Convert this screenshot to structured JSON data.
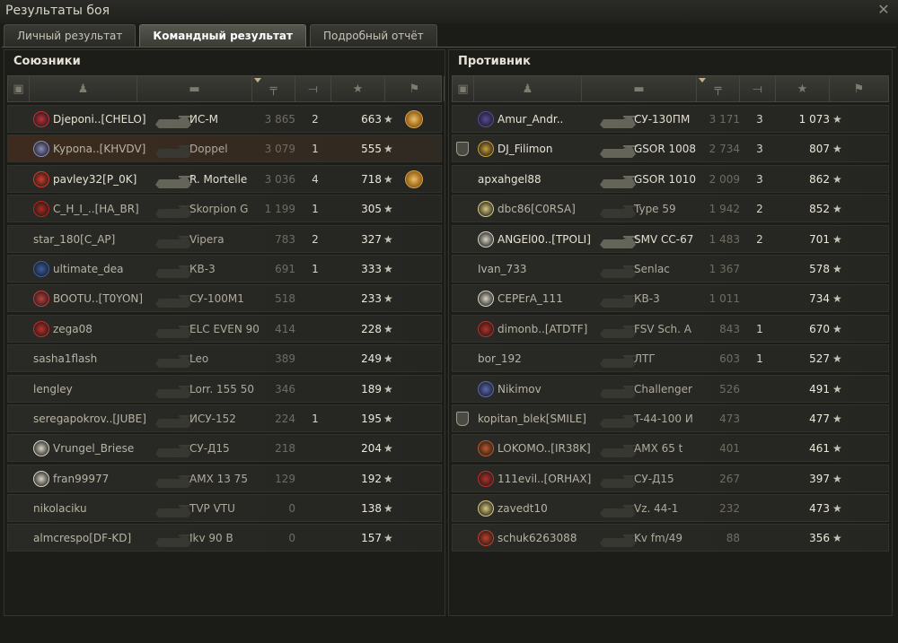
{
  "window": {
    "title": "Результаты боя",
    "close_glyph": "✕"
  },
  "tabs": [
    {
      "label": "Личный результат",
      "active": false
    },
    {
      "label": "Командный результат",
      "active": true
    },
    {
      "label": "Подробный отчёт",
      "active": false
    }
  ],
  "allies": {
    "title": "Союзники",
    "rows": [
      {
        "player": "Djeponi..[CHELO]",
        "clan_icon": "red-circle-clan-icon",
        "clan_color": "#c0303a",
        "vehicle": "ИС-М",
        "damage": "3 865",
        "kills": "2",
        "xp": "663",
        "medal": true,
        "alive": true
      },
      {
        "player": "Kypona..[KHVDV]",
        "clan_icon": "white-swirl-clan-icon",
        "clan_color": "#8a8cc0",
        "vehicle": "Doppel",
        "damage": "3 079",
        "kills": "1",
        "xp": "555",
        "medal": false,
        "alive": false,
        "highlight": true
      },
      {
        "player": "pavley32[P_0K]",
        "clan_icon": "red-triangle-clan-icon",
        "clan_color": "#d63a2a",
        "vehicle": "R. Mortelle",
        "damage": "3 036",
        "kills": "4",
        "xp": "718",
        "medal": true,
        "alive": true
      },
      {
        "player": "C_H_I_..[HA_BR]",
        "clan_icon": "red-flag-clan-icon",
        "clan_color": "#b02a22",
        "vehicle": "Skorpion G",
        "damage": "1 199",
        "kills": "1",
        "xp": "305",
        "medal": false,
        "alive": false
      },
      {
        "player": "star_180[C_AP]",
        "clan_icon": "",
        "clan_color": "",
        "vehicle": "Vipera",
        "damage": "783",
        "kills": "2",
        "xp": "327",
        "medal": false,
        "alive": false
      },
      {
        "player": "ultimate_dea",
        "clan_icon": "blue-flag-clan-icon",
        "clan_color": "#3a5ea8",
        "vehicle": "КВ-3",
        "damage": "691",
        "kills": "1",
        "xp": "333",
        "medal": false,
        "alive": false
      },
      {
        "player": "BOOTU..[T0YON]",
        "clan_icon": "red-white-clan-icon",
        "clan_color": "#c04040",
        "vehicle": "СУ-100М1",
        "damage": "518",
        "kills": "",
        "xp": "233",
        "medal": false,
        "alive": false
      },
      {
        "player": "zega08",
        "clan_icon": "diamond-clan-icon",
        "clan_color": "#c0302a",
        "vehicle": "ELC EVEN 90",
        "damage": "414",
        "kills": "",
        "xp": "228",
        "medal": false,
        "alive": false
      },
      {
        "player": "sasha1flash",
        "clan_icon": "",
        "clan_color": "",
        "vehicle": "Leo",
        "damage": "389",
        "kills": "",
        "xp": "249",
        "medal": false,
        "alive": false
      },
      {
        "player": "lengley",
        "clan_icon": "",
        "clan_color": "",
        "vehicle": "Lorr. 155 50",
        "damage": "346",
        "kills": "",
        "xp": "189",
        "medal": false,
        "alive": false
      },
      {
        "player": "seregapokrov..[JUBE]",
        "clan_icon": "",
        "clan_color": "",
        "vehicle": "ИСУ-152",
        "damage": "224",
        "kills": "1",
        "xp": "195",
        "medal": false,
        "alive": false
      },
      {
        "player": "Vrungel_Briese",
        "clan_icon": "diamond-clan-icon",
        "clan_color": "#d8d4c6",
        "vehicle": "СУ-Д15",
        "damage": "218",
        "kills": "",
        "xp": "204",
        "medal": false,
        "alive": false
      },
      {
        "player": "fran99977",
        "clan_icon": "diamond-clan-icon",
        "clan_color": "#d8d4c6",
        "vehicle": "AMX 13 75",
        "damage": "129",
        "kills": "",
        "xp": "192",
        "medal": false,
        "alive": false
      },
      {
        "player": "nikolaciku",
        "clan_icon": "",
        "clan_color": "",
        "vehicle": "TVP VTU",
        "damage": "0",
        "kills": "",
        "xp": "138",
        "medal": false,
        "alive": false
      },
      {
        "player": "almcrespo[DF-KD]",
        "clan_icon": "",
        "clan_color": "",
        "vehicle": "Ikv 90 B",
        "damage": "0",
        "kills": "",
        "xp": "157",
        "medal": false,
        "alive": false
      }
    ]
  },
  "enemies": {
    "title": "Противник",
    "rows": [
      {
        "player": "Amur_Andr..",
        "clan_icon": "b-badge-clan-icon",
        "clan_color": "#5a4aa0",
        "vehicle": "СУ-130ПМ",
        "damage": "3 171",
        "kills": "3",
        "xp": "1 073",
        "alive": true,
        "rank": false
      },
      {
        "player": "DJ_Filimon",
        "clan_icon": "gold-ring-clan-icon",
        "clan_color": "#c9a03a",
        "vehicle": "GSOR 1008",
        "damage": "2 734",
        "kills": "3",
        "xp": "807",
        "alive": true,
        "rank": true
      },
      {
        "player": "apxahgel88",
        "clan_icon": "",
        "clan_color": "",
        "vehicle": "GSOR 1010",
        "damage": "2 009",
        "kills": "3",
        "xp": "862",
        "alive": true,
        "rank": false
      },
      {
        "player": "dbc86[C0RSA]",
        "clan_icon": "star-burst-clan-icon",
        "clan_color": "#d8c880",
        "vehicle": "Type 59",
        "damage": "1 942",
        "kills": "2",
        "xp": "852",
        "alive": false,
        "rank": false
      },
      {
        "player": "ANGEl00..[TPOLI]",
        "clan_icon": "diamond-clan-icon",
        "clan_color": "#d8d4c6",
        "vehicle": "SMV CC-67",
        "damage": "1 483",
        "kills": "2",
        "xp": "701",
        "alive": true,
        "rank": false
      },
      {
        "player": "Ivan_733",
        "clan_icon": "",
        "clan_color": "",
        "vehicle": "Senlac",
        "damage": "1 367",
        "kills": "",
        "xp": "578",
        "alive": false,
        "rank": false
      },
      {
        "player": "СЕРЕrA_111",
        "clan_icon": "diamond-clan-icon",
        "clan_color": "#d8d4c6",
        "vehicle": "КВ-3",
        "damage": "1 011",
        "kills": "",
        "xp": "734",
        "alive": false,
        "rank": false
      },
      {
        "player": "dimonb..[ATDTF]",
        "clan_icon": "red-shield-clan-icon",
        "clan_color": "#b8302a",
        "vehicle": "FSV Sch. A",
        "damage": "843",
        "kills": "1",
        "xp": "670",
        "alive": false,
        "rank": false
      },
      {
        "player": "bor_192",
        "clan_icon": "",
        "clan_color": "",
        "vehicle": "ЛТГ",
        "damage": "603",
        "kills": "1",
        "xp": "527",
        "alive": false,
        "rank": false
      },
      {
        "player": "Nikimov",
        "clan_icon": "star-burst-clan-icon",
        "clan_color": "#5a6ab8",
        "vehicle": "Challenger",
        "damage": "526",
        "kills": "",
        "xp": "491",
        "alive": false,
        "rank": false
      },
      {
        "player": "kopitan_blek[SMILE]",
        "clan_icon": "",
        "clan_color": "",
        "vehicle": "T-44-100 И",
        "damage": "473",
        "kills": "",
        "xp": "477",
        "alive": false,
        "rank": true
      },
      {
        "player": "LOKOMO..[IR38K]",
        "clan_icon": "wreath-clan-icon",
        "clan_color": "#c05a2a",
        "vehicle": "AMX 65 t",
        "damage": "401",
        "kills": "",
        "xp": "461",
        "alive": false,
        "rank": false
      },
      {
        "player": "111evil..[ORHAX]",
        "clan_icon": "red-shield-clan-icon",
        "clan_color": "#b8302a",
        "vehicle": "СУ-Д15",
        "damage": "267",
        "kills": "",
        "xp": "397",
        "alive": false,
        "rank": false
      },
      {
        "player": "zavedt10",
        "clan_icon": "star-burst-clan-icon",
        "clan_color": "#d8c880",
        "vehicle": "Vz. 44-1",
        "damage": "232",
        "kills": "",
        "xp": "473",
        "alive": false,
        "rank": false
      },
      {
        "player": "schuk6263088",
        "clan_icon": "red-shield-clan-icon",
        "clan_color": "#c0402a",
        "vehicle": "Kv fm/49",
        "damage": "88",
        "kills": "",
        "xp": "356",
        "alive": false,
        "rank": false
      }
    ]
  },
  "columns": [
    {
      "icon": "rank-badge-icon"
    },
    {
      "icon": "player-silhouette-icon"
    },
    {
      "icon": "tank-silhouette-icon"
    },
    {
      "icon": "damage-gun-icon"
    },
    {
      "icon": "kills-tank-icon"
    },
    {
      "icon": "xp-star-icon"
    },
    {
      "icon": "medal-icon"
    }
  ]
}
